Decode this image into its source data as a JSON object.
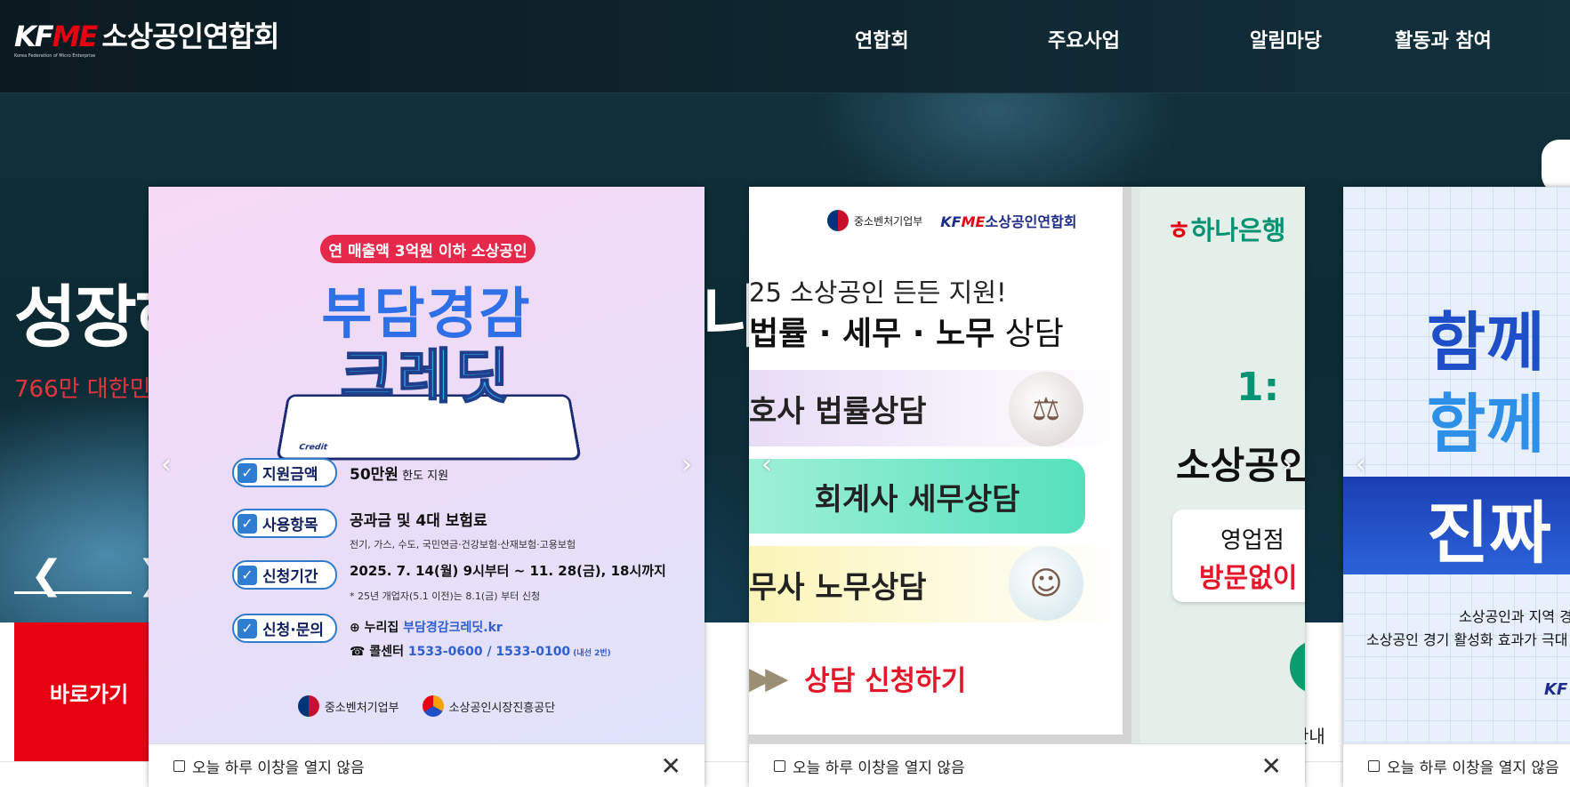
{
  "header": {
    "logo_mark_a": "KF",
    "logo_mark_b": "ME",
    "logo_sub": "Korea Federation of Micro Enterprise",
    "logo_name": "소상공인연합회",
    "nav": [
      "연합회",
      "주요사업",
      "알림마당",
      "활동과 참여"
    ]
  },
  "hero": {
    "title": "성장하",
    "title_tail": "나는",
    "subtitle": "766만 대한민",
    "prev_glyph": "❮",
    "next_glyph": "❯"
  },
  "quick": {
    "button_label": "바로가기",
    "tail_text": "안내"
  },
  "popups": [
    {
      "badge": "연 매출액 3억원 이하 소상공인",
      "title_line1": "부담경감",
      "title_line2": "크레딧",
      "card_label": "Credit",
      "rows": [
        {
          "tag": "지원금액",
          "value": "50만원",
          "value_small": " 한도 지원"
        },
        {
          "tag": "사용항목",
          "value": "공과금 및 4대 보험료",
          "note": "전기, 가스, 수도, 국민연금·건강보험·산재보험·고용보험"
        },
        {
          "tag": "신청기간",
          "value": "2025. 7. 14(월) 9시부터 ~ 11. 28(금), 18시까지",
          "note": "* 25년 개업자(5.1 이전)는 8.1(금) 부터 신청"
        },
        {
          "tag": "신청·문의",
          "value_prefix": "⊕ 누리집 ",
          "value": "부담경감크레딧.kr",
          "value2_prefix": "☎ 콜센터 ",
          "value2": "1533-0600 / 1533-0100",
          "value2_small": " (내선 2번)"
        }
      ],
      "org1": "중소벤처기업부",
      "org2": "소상공인시장진흥공단",
      "footer_label": "오늘 하루 이창을 열지 않음",
      "close_glyph": "✕"
    },
    {
      "org_ministry": "중소벤처기업부",
      "org_kfme_a": "KF",
      "org_kfme_b": "ME",
      "org_kfme_name": "소상공인연합회",
      "line1": "25 소상공인 든든 지원!",
      "line2_bold": "법률 · 세무 · 노무",
      "line2_rest": " 상담",
      "bar1": "호사 법률상담",
      "bar2": "회계사 세무상담",
      "bar3": "무사 노무상담",
      "cta": "상담 신청하기",
      "bank": "하나은행",
      "right1": "1:",
      "right2": "소상공인",
      "right_card1": "영업점",
      "right_card2": "방문없이",
      "footer_label": "오늘 하루 이창을 열지 않음",
      "close_glyph": "✕"
    },
    {
      "title1": "함께",
      "title2": "함께",
      "big": "진짜",
      "sub1": "소상공인과 지역 경",
      "sub2": "소상공인 경기 활성화 효과가 극대",
      "kf": "KF",
      "footer_label": "오늘 하루 이창을 열지 않음"
    }
  ],
  "colors": {
    "brand_red": "#e60012",
    "popup1_blue": "#2f6fe8",
    "hana_green": "#049372"
  }
}
